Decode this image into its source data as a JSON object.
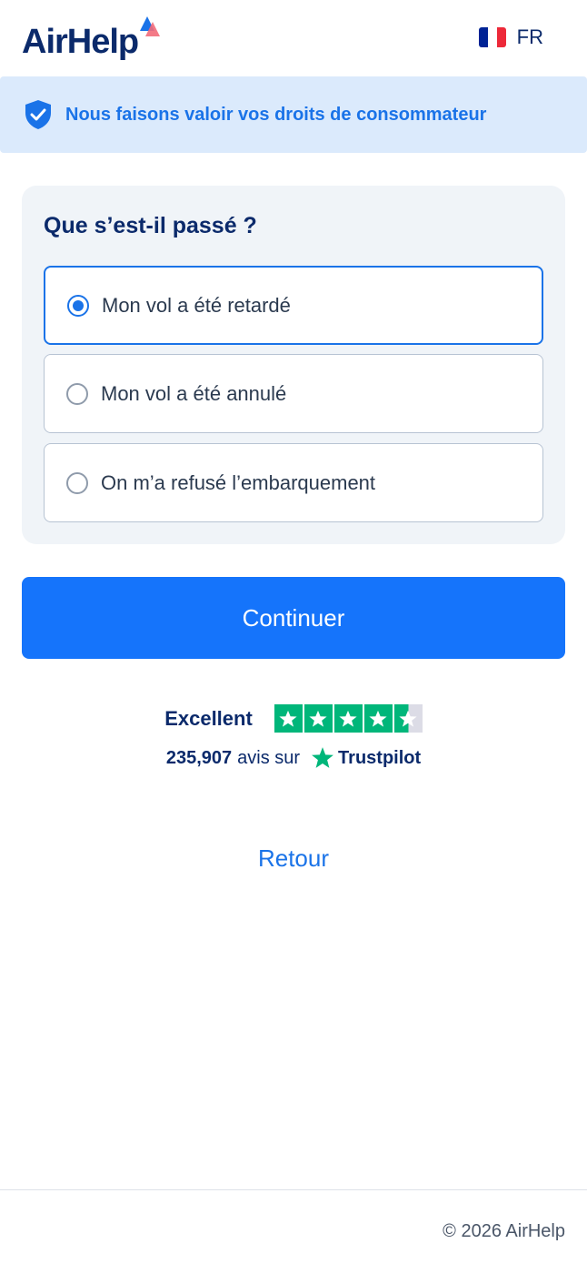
{
  "header": {
    "logo_text": "AirHelp",
    "language_label": "FR",
    "flag_colors": [
      "#002395",
      "#ffffff",
      "#ed2939"
    ]
  },
  "banner": {
    "text": "Nous faisons valoir vos droits de consommateur",
    "icon": "shield-check-icon"
  },
  "form": {
    "title": "Que s’est-il passé ?",
    "options": [
      {
        "label": "Mon vol a été retardé",
        "selected": true
      },
      {
        "label": "Mon vol a été annulé",
        "selected": false
      },
      {
        "label": "On m’a refusé l’embarquement",
        "selected": false
      }
    ]
  },
  "actions": {
    "continue_label": "Continuer",
    "back_label": "Retour"
  },
  "trustpilot": {
    "rating_label": "Excellent",
    "stars": 4.5,
    "review_count": "235,907",
    "reviews_text": "avis sur",
    "brand": "Trustpilot"
  },
  "footer": {
    "copyright": "© 2026 AirHelp"
  },
  "colors": {
    "brand_navy": "#0b2a6b",
    "accent_blue": "#1574fb",
    "trustpilot_green": "#00b67a",
    "banner_bg": "#dbeafc"
  }
}
